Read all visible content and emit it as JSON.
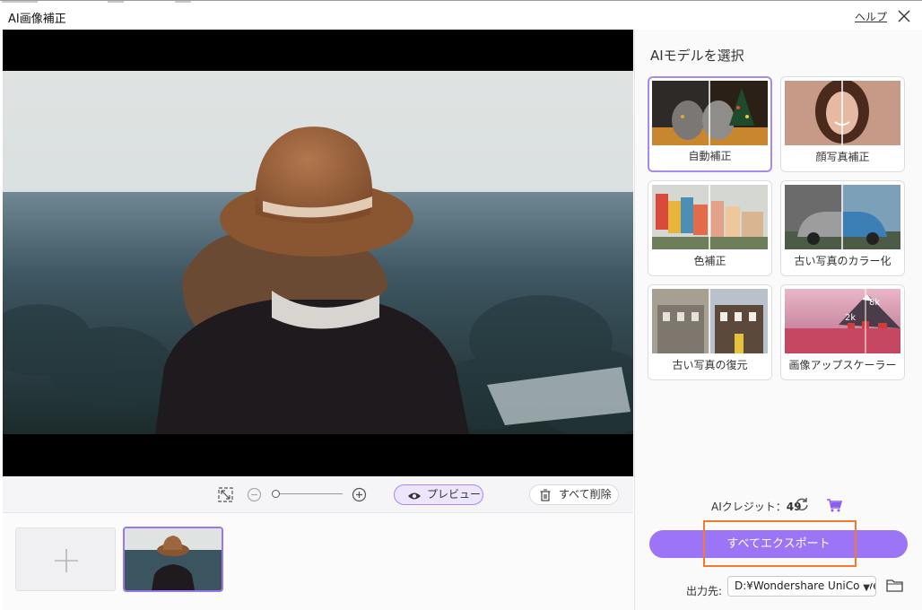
{
  "window": {
    "title": "AI画像補正",
    "help_label": "ヘルプ"
  },
  "right_panel": {
    "title": "AIモデルを選択",
    "models": [
      {
        "label": "自動補正",
        "selected": true
      },
      {
        "label": "顔写真補正",
        "selected": false
      },
      {
        "label": "色補正",
        "selected": false
      },
      {
        "label": "古い写真のカラー化",
        "selected": false
      },
      {
        "label": "古い写真の復元",
        "selected": false
      },
      {
        "label": "画像アップスケーラー",
        "selected": false
      }
    ],
    "upscale_badges": {
      "a": "2k",
      "b": "8k"
    },
    "credit_label": "AIクレジット：",
    "credit_value": "49",
    "export_label": "すべてエクスポート",
    "output_label": "出力先:",
    "output_path": "D:¥Wondershare UniConverter"
  },
  "toolbar": {
    "preview_label": "プレビュー",
    "delete_all_label": "すべて削除"
  },
  "colors": {
    "accent": "#9c74f6",
    "highlight": "#f07a2e"
  }
}
